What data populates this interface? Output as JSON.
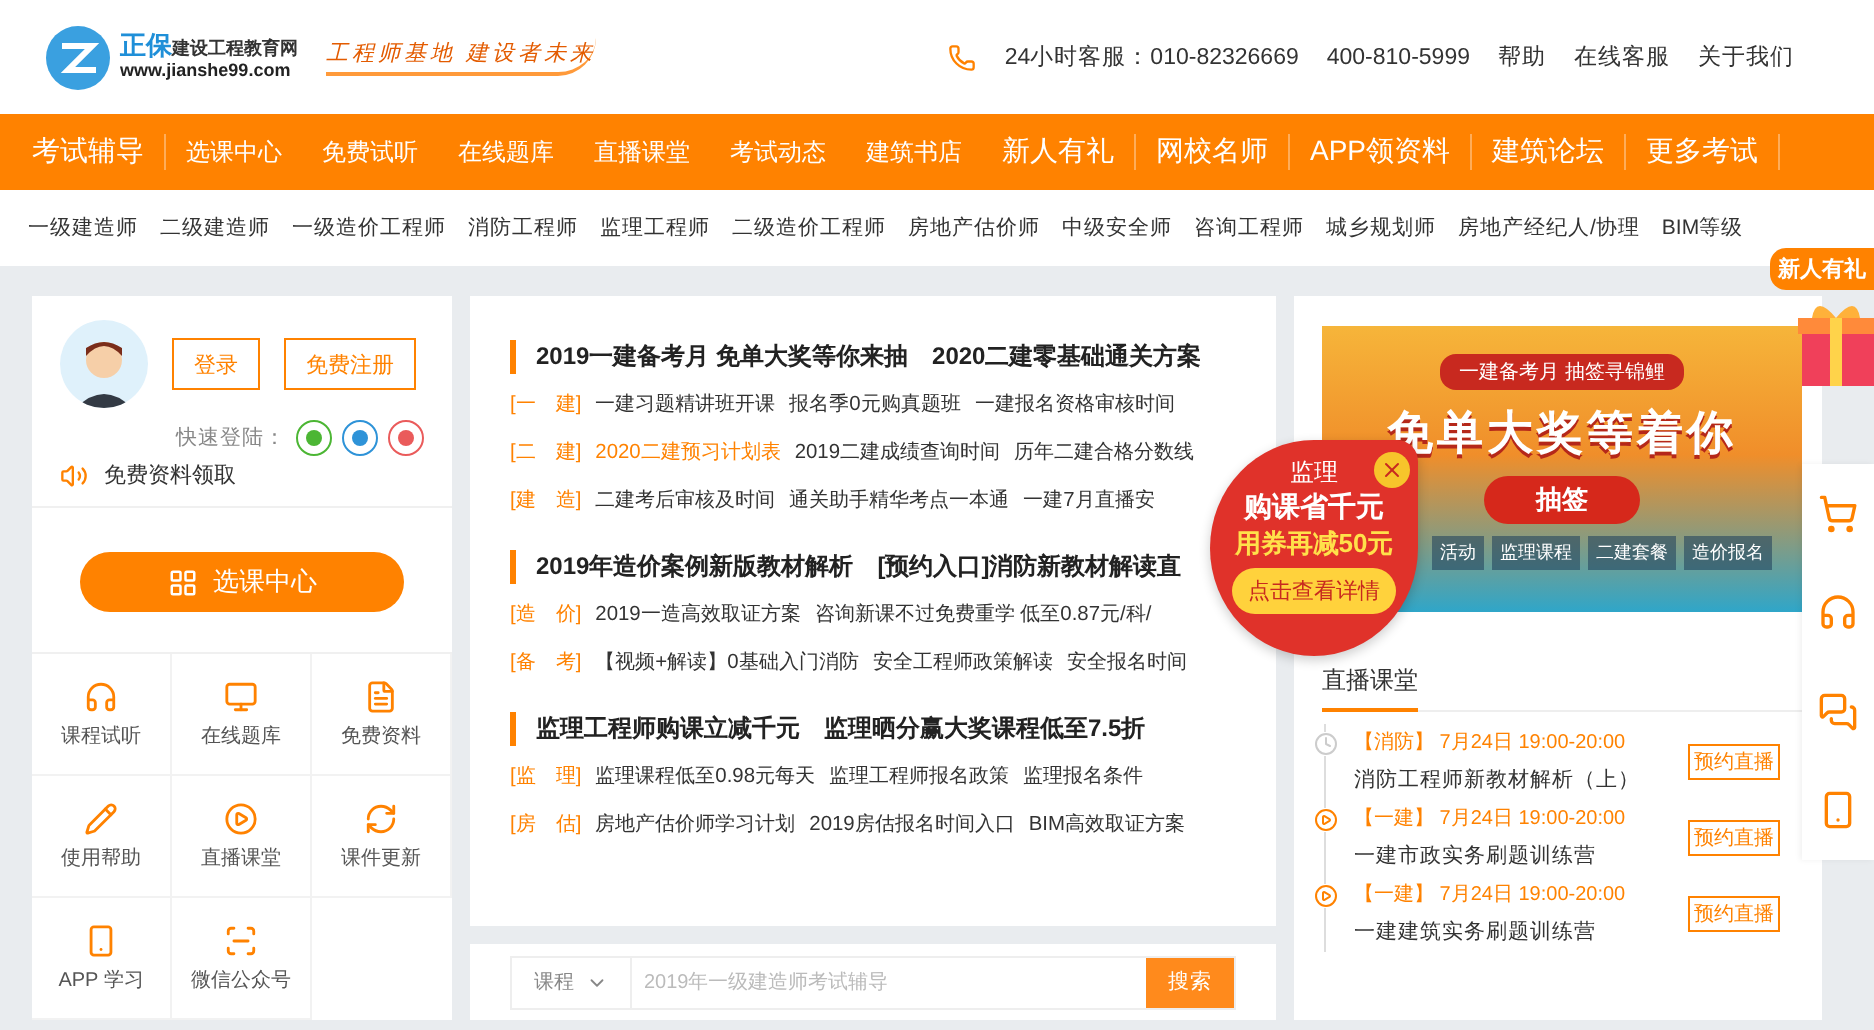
{
  "header": {
    "logo": {
      "brand": "正保",
      "name": "建设工程教育网",
      "url": "www.jianshe99.com"
    },
    "slogan": "工程师基地 建设者未来",
    "hotline": "24小时客服：010-82326669",
    "phone": "400-810-5999",
    "links": [
      "帮助",
      "在线客服",
      "关于我们"
    ]
  },
  "main_nav": [
    {
      "label": "考试辅导",
      "kind": "major"
    },
    {
      "label": "选课中心",
      "kind": "minor"
    },
    {
      "label": "免费试听",
      "kind": "minor"
    },
    {
      "label": "在线题库",
      "kind": "minor"
    },
    {
      "label": "直播课堂",
      "kind": "minor"
    },
    {
      "label": "考试动态",
      "kind": "minor"
    },
    {
      "label": "建筑书店",
      "kind": "minor"
    },
    {
      "label": "新人有礼",
      "kind": "major"
    },
    {
      "label": "网校名师",
      "kind": "major"
    },
    {
      "label": "APP领资料",
      "kind": "major"
    },
    {
      "label": "建筑论坛",
      "kind": "major"
    },
    {
      "label": "更多考试",
      "kind": "major"
    }
  ],
  "exam_nav": [
    "一级建造师",
    "二级建造师",
    "一级造价工程师",
    "消防工程师",
    "监理工程师",
    "二级造价工程师",
    "房地产估价师",
    "中级安全师",
    "咨询工程师",
    "城乡规划师",
    "房地产经纪人/协理",
    "BIM等级"
  ],
  "login_card": {
    "buttons": [
      "登录",
      "免费注册"
    ],
    "quick_login": "快速登陆：",
    "free_materials": "免费资料领取",
    "course_center": "选课中心",
    "shortcuts": [
      "课程试听",
      "在线题库",
      "免费资料",
      "使用帮助",
      "直播课堂",
      "课件更新",
      "APP 学习",
      "微信公众号"
    ]
  },
  "news": [
    {
      "headings": [
        "2019一建备考月 免单大奖等你来抽",
        "2020二建零基础通关方案"
      ],
      "rows": [
        {
          "tag": "[一　建]",
          "links": [
            {
              "text": "一建习题精讲班开课",
              "highlight": false
            },
            {
              "text": "报名季0元购真题班",
              "highlight": false
            },
            {
              "text": "一建报名资格审核时间",
              "highlight": false
            }
          ]
        },
        {
          "tag": "[二　建]",
          "links": [
            {
              "text": "2020二建预习计划表",
              "highlight": true
            },
            {
              "text": "2019二建成绩查询时间",
              "highlight": false
            },
            {
              "text": "历年二建合格分数线",
              "highlight": false
            }
          ]
        },
        {
          "tag": "[建　造]",
          "links": [
            {
              "text": "二建考后审核及时间",
              "highlight": false
            },
            {
              "text": "通关助手精华考点一本通",
              "highlight": false
            },
            {
              "text": "一建7月直播安",
              "highlight": false
            }
          ]
        }
      ]
    },
    {
      "headings": [
        "2019年造价案例新版教材解析",
        "[预约入口]消防新教材解读直"
      ],
      "rows": [
        {
          "tag": "[造　价]",
          "links": [
            {
              "text": "2019一造高效取证方案",
              "highlight": false
            },
            {
              "text": "咨询新课不过免费重学 低至0.87元/科/",
              "highlight": false
            }
          ]
        },
        {
          "tag": "[备　考]",
          "links": [
            {
              "text": "【视频+解读】0基础入门消防",
              "highlight": false
            },
            {
              "text": "安全工程师政策解读",
              "highlight": false
            },
            {
              "text": "安全报名时间",
              "highlight": false
            }
          ]
        }
      ]
    },
    {
      "headings": [
        "监理工程师购课立减千元",
        "监理晒分赢大奖课程低至7.5折"
      ],
      "rows": [
        {
          "tag": "[监　理]",
          "links": [
            {
              "text": "监理课程低至0.98元每天",
              "highlight": false
            },
            {
              "text": "监理工程师报名政策",
              "highlight": false
            },
            {
              "text": "监理报名条件",
              "highlight": false
            }
          ]
        },
        {
          "tag": "[房　估]",
          "links": [
            {
              "text": "房地产估价师学习计划",
              "highlight": false
            },
            {
              "text": "2019房估报名时间入口",
              "highlight": false
            },
            {
              "text": "BIM高效取证方案",
              "highlight": false
            }
          ]
        }
      ]
    }
  ],
  "search": {
    "category": "课程",
    "placeholder": "2019年一级建造师考试辅导",
    "button": "搜索"
  },
  "banner": {
    "ribbon": "一建备考月 抽签寻锦鲤",
    "headline": "免单大奖等着你",
    "button": "抽签",
    "tags": [
      "活动",
      "监理课程",
      "二建套餐",
      "造价报名"
    ]
  },
  "live": {
    "title": "直播课堂",
    "items": [
      {
        "kind": "clock",
        "tag": "【消防】",
        "time": "7月24日 19:00-20:00",
        "title": "消防工程师新教材解析（上）",
        "button": "预约直播"
      },
      {
        "kind": "play",
        "tag": "【一建】",
        "time": "7月24日 19:00-20:00",
        "title": "一建市政实务刷题训练营",
        "button": "预约直播"
      },
      {
        "kind": "play",
        "tag": "【一建】",
        "time": "7月24日 19:00-20:00",
        "title": "一建建筑实务刷题训练营",
        "button": "预约直播"
      }
    ]
  },
  "promo_popup": {
    "line1": "监理",
    "line2": "购课省千元",
    "line3": "用券再减50元",
    "button": "点击查看详情"
  },
  "side_tools": {
    "gift_label": "新人有礼"
  }
}
